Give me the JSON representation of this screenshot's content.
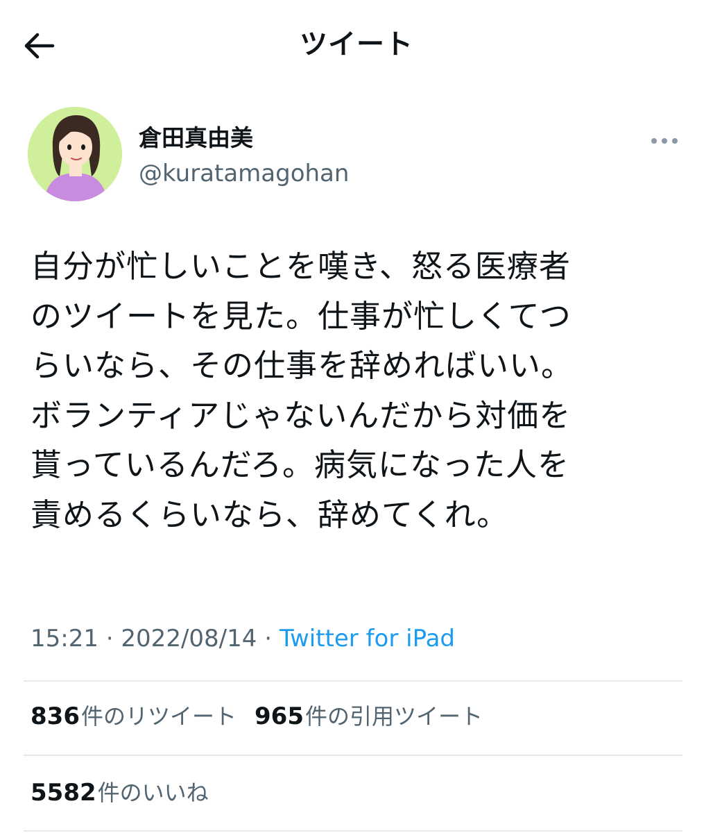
{
  "header": {
    "title": "ツイート",
    "back_icon": "arrow-left-icon"
  },
  "author": {
    "display_name": "倉田真由美",
    "handle": "@kuratamagohan",
    "avatar_bg": "#cfef9a",
    "more_icon": "more-horizontal-icon"
  },
  "tweet": {
    "lines": [
      "自分が忙しいことを嘆き、怒る医療者",
      "のツイートを見た。仕事が忙しくてつ",
      "らいなら、その仕事を辞めればいい。",
      "ボランティアじゃないんだから対価を",
      "貰っているんだろ。病気になった人を",
      "責めるくらいなら、辞めてくれ。"
    ],
    "time": "15:21",
    "separator": "·",
    "date": "2022/08/14",
    "source": "Twitter for iPad"
  },
  "stats": {
    "retweets_count": "836",
    "retweets_label": "件のリツイート",
    "quotes_count": "965",
    "quotes_label": "件の引用ツイート",
    "likes_count": "5582",
    "likes_label": "件のいいね"
  },
  "colors": {
    "text": "#0f1419",
    "secondary": "#536471",
    "link": "#1d9bf0",
    "divider": "#e7e9ea"
  }
}
